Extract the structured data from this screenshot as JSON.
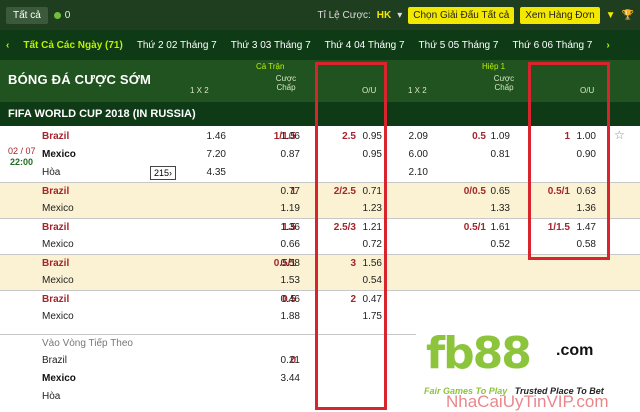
{
  "topbar": {
    "all_label": "Tất cả",
    "count": "0",
    "odds_label": "Tỉ Lệ Cược:",
    "odds_value": "HK",
    "select_league": "Chọn Giải Đấu",
    "select_league_value": "Tất cả",
    "view_orders": "Xem Hàng Đơn"
  },
  "days": [
    "Tất Cả Các Ngày (71)",
    "Thứ 2 02 Tháng 7",
    "Thứ 3 03 Tháng 7",
    "Thứ 4 04 Tháng 7",
    "Thứ 5 05 Tháng 7",
    "Thứ 6 06 Tháng 7"
  ],
  "header": {
    "title": "BÓNG ĐÁ CƯỢC SỚM",
    "full_time": "Cả Trận",
    "first_half": "Hiệp 1",
    "col_1x2": "1 X 2",
    "col_handicap": "Cược Chấp",
    "col_ou": "O/U"
  },
  "league": "FIFA WORLD CUP 2018 (IN RUSSIA)",
  "match": {
    "date": "02 / 07",
    "time": "22:00",
    "more": "215"
  },
  "rows": [
    {
      "team": "Brazil",
      "cls": "fav",
      "x12": "1.46",
      "hc": "1/1.5",
      "hco": "1.06",
      "ou": "2.5",
      "ouo": "0.95",
      "h_x12": "2.09",
      "h_hc": "0.5",
      "h_hco": "1.09",
      "h_ou": "1",
      "h_ouo": "1.00",
      "alt": false
    },
    {
      "team": "Mexico",
      "cls": "bold",
      "x12": "7.20",
      "hc": "",
      "hco": "0.87",
      "ou": "",
      "ouo": "0.95",
      "h_x12": "6.00",
      "h_hc": "",
      "h_hco": "0.81",
      "h_ou": "",
      "h_ouo": "0.90",
      "alt": false
    },
    {
      "team": "Hòa",
      "cls": "",
      "x12": "4.35",
      "hc": "",
      "hco": "",
      "ou": "",
      "ouo": "",
      "h_x12": "2.10",
      "h_hc": "",
      "h_hco": "",
      "h_ou": "",
      "h_ouo": "",
      "alt": false
    },
    {
      "team": "Brazil",
      "cls": "fav",
      "x12": "",
      "hc": "1",
      "hco": "0.77",
      "ou": "2/2.5",
      "ouo": "0.71",
      "h_x12": "",
      "h_hc": "0/0.5",
      "h_hco": "0.65",
      "h_ou": "0.5/1",
      "h_ouo": "0.63",
      "alt": true
    },
    {
      "team": "Mexico",
      "cls": "",
      "x12": "",
      "hc": "",
      "hco": "1.19",
      "ou": "",
      "ouo": "1.23",
      "h_x12": "",
      "h_hc": "",
      "h_hco": "1.33",
      "h_ou": "",
      "h_ouo": "1.36",
      "alt": true
    },
    {
      "team": "Brazil",
      "cls": "fav",
      "x12": "",
      "hc": "1.5",
      "hco": "1.36",
      "ou": "2.5/3",
      "ouo": "1.21",
      "h_x12": "",
      "h_hc": "0.5/1",
      "h_hco": "1.61",
      "h_ou": "1/1.5",
      "h_ouo": "1.47",
      "alt": false
    },
    {
      "team": "Mexico",
      "cls": "",
      "x12": "",
      "hc": "",
      "hco": "0.66",
      "ou": "",
      "ouo": "0.72",
      "h_x12": "",
      "h_hc": "",
      "h_hco": "0.52",
      "h_ou": "",
      "h_ouo": "0.58",
      "alt": false
    },
    {
      "team": "Brazil",
      "cls": "fav",
      "x12": "",
      "hc": "0.5/1",
      "hco": "0.58",
      "ou": "3",
      "ouo": "1.56",
      "h_x12": "",
      "h_hc": "",
      "h_hco": "",
      "h_ou": "",
      "h_ouo": "",
      "alt": true
    },
    {
      "team": "Mexico",
      "cls": "",
      "x12": "",
      "hc": "",
      "hco": "1.53",
      "ou": "",
      "ouo": "0.54",
      "h_x12": "",
      "h_hc": "",
      "h_hco": "",
      "h_ou": "",
      "h_ouo": "",
      "alt": true
    },
    {
      "team": "Brazil",
      "cls": "fav",
      "x12": "",
      "hc": "0.5",
      "hco": "0.46",
      "ou": "2",
      "ouo": "0.47",
      "h_x12": "",
      "h_hc": "",
      "h_hco": "",
      "h_ou": "",
      "h_ouo": "",
      "alt": false
    },
    {
      "team": "Mexico",
      "cls": "",
      "x12": "",
      "hc": "",
      "hco": "1.88",
      "ou": "",
      "ouo": "1.75",
      "h_x12": "",
      "h_hc": "",
      "h_hco": "",
      "h_ou": "",
      "h_ouo": "",
      "alt": false
    }
  ],
  "qualify": {
    "label": "Vào Vòng Tiếp Theo",
    "rows": [
      {
        "team": "Brazil",
        "cls": "",
        "hc": "0",
        "hco": "0.21"
      },
      {
        "team": "Mexico",
        "cls": "bold",
        "hc": "",
        "hco": "3.44"
      },
      {
        "team": "Hòa",
        "cls": "",
        "hc": "",
        "hco": ""
      }
    ]
  },
  "ad": {
    "brand": "fb88",
    "domain": ".com",
    "tagline_a": "Fair Games To Play",
    "tagline_b": "Trusted Place To Bet",
    "watermark": "NhaCaiUyTinVIP.com"
  },
  "colors": {
    "dark_green": "#1f3d1f",
    "accent_yellow": "#f3e800",
    "red_box": "#d8252d"
  }
}
